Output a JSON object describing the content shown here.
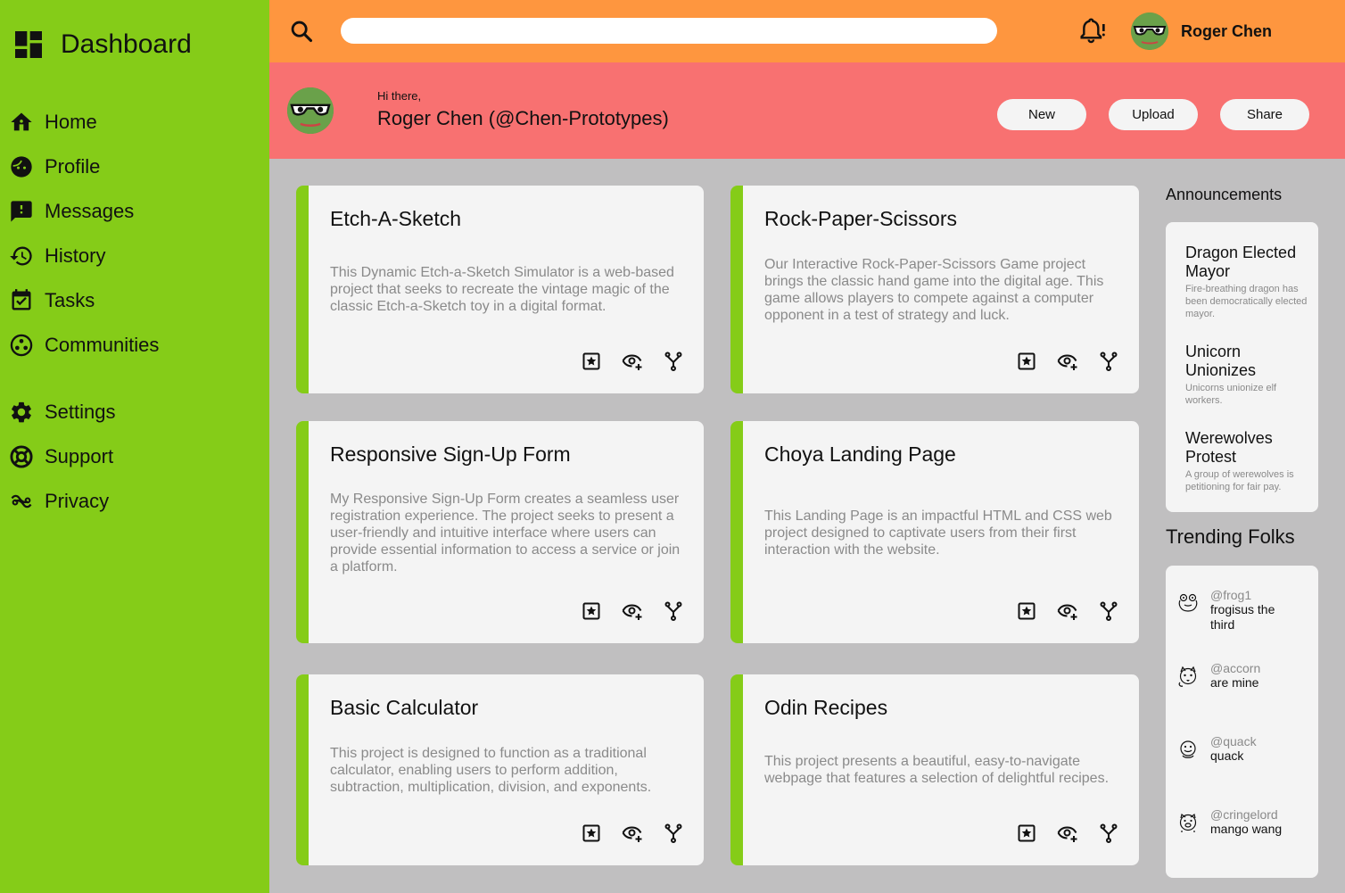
{
  "sidebar": {
    "title": "Dashboard",
    "items": [
      {
        "label": "Home",
        "icon": "home-icon"
      },
      {
        "label": "Profile",
        "icon": "profile-face-icon"
      },
      {
        "label": "Messages",
        "icon": "message-alert-icon"
      },
      {
        "label": "History",
        "icon": "history-icon"
      },
      {
        "label": "Tasks",
        "icon": "calendar-check-icon"
      },
      {
        "label": "Communities",
        "icon": "communities-icon"
      },
      {
        "label": "Settings",
        "icon": "gear-icon"
      },
      {
        "label": "Support",
        "icon": "lifebuoy-icon"
      },
      {
        "label": "Privacy",
        "icon": "privacy-icon"
      }
    ]
  },
  "topbar": {
    "search_placeholder": "",
    "user_name": "Roger Chen"
  },
  "greeting": {
    "hi": "Hi there,",
    "name": "Roger Chen (@Chen-Prototypes)",
    "buttons": {
      "new": "New",
      "upload": "Upload",
      "share": "Share"
    }
  },
  "projects": [
    {
      "title": "Etch-A-Sketch",
      "description": "This Dynamic Etch-a-Sketch Simulator is a web-based project that seeks to recreate the vintage magic of the classic Etch-a-Sketch toy in a digital format."
    },
    {
      "title": "Rock-Paper-Scissors",
      "description": "Our Interactive Rock-Paper-Scissors Game project brings the classic hand game into the digital age. This game allows players to compete against a computer opponent in a test of strategy and luck."
    },
    {
      "title": "Responsive Sign-Up Form",
      "description": "My Responsive Sign-Up Form creates a seamless user registration experience. The project seeks to present a user-friendly and intuitive interface where users can provide essential information to access a service or join a platform."
    },
    {
      "title": "Choya Landing Page",
      "description": "This Landing Page is an impactful HTML and CSS web project designed to captivate users from their first interaction with the website."
    },
    {
      "title": "Basic Calculator",
      "description": "This project is designed to function as a traditional calculator, enabling users to perform addition, subtraction, multiplication, division, and exponents."
    },
    {
      "title": "Odin Recipes",
      "description": "This project presents a beautiful, easy-to-navigate webpage that features a selection of delightful recipes."
    }
  ],
  "announcements": {
    "heading": "Announcements",
    "items": [
      {
        "title": "Dragon Elected Mayor",
        "description": "Fire-breathing dragon has been democratically elected mayor."
      },
      {
        "title": "Unicorn Unionizes",
        "description": "Unicorns unionize elf workers."
      },
      {
        "title": "Werewolves Protest",
        "description": "A group of werewolves is petitioning for fair pay."
      }
    ]
  },
  "trending": {
    "heading": "Trending Folks",
    "folks": [
      {
        "handle": "@frog1",
        "name": "frogisus the third",
        "icon": "frog-avatar-icon"
      },
      {
        "handle": "@accorn",
        "name": "are mine",
        "icon": "squirrel-avatar-icon"
      },
      {
        "handle": "@quack",
        "name": "quack",
        "icon": "duck-avatar-icon"
      },
      {
        "handle": "@cringelord",
        "name": "mango wang",
        "icon": "pig-avatar-icon"
      }
    ]
  },
  "colors": {
    "sidebar": "#85cc18",
    "topbar": "#fe963f",
    "greeting": "#f87171",
    "content_bg": "#c0bfc0",
    "card_bg": "#f4f4f4",
    "card_accent": "#85cc18"
  }
}
